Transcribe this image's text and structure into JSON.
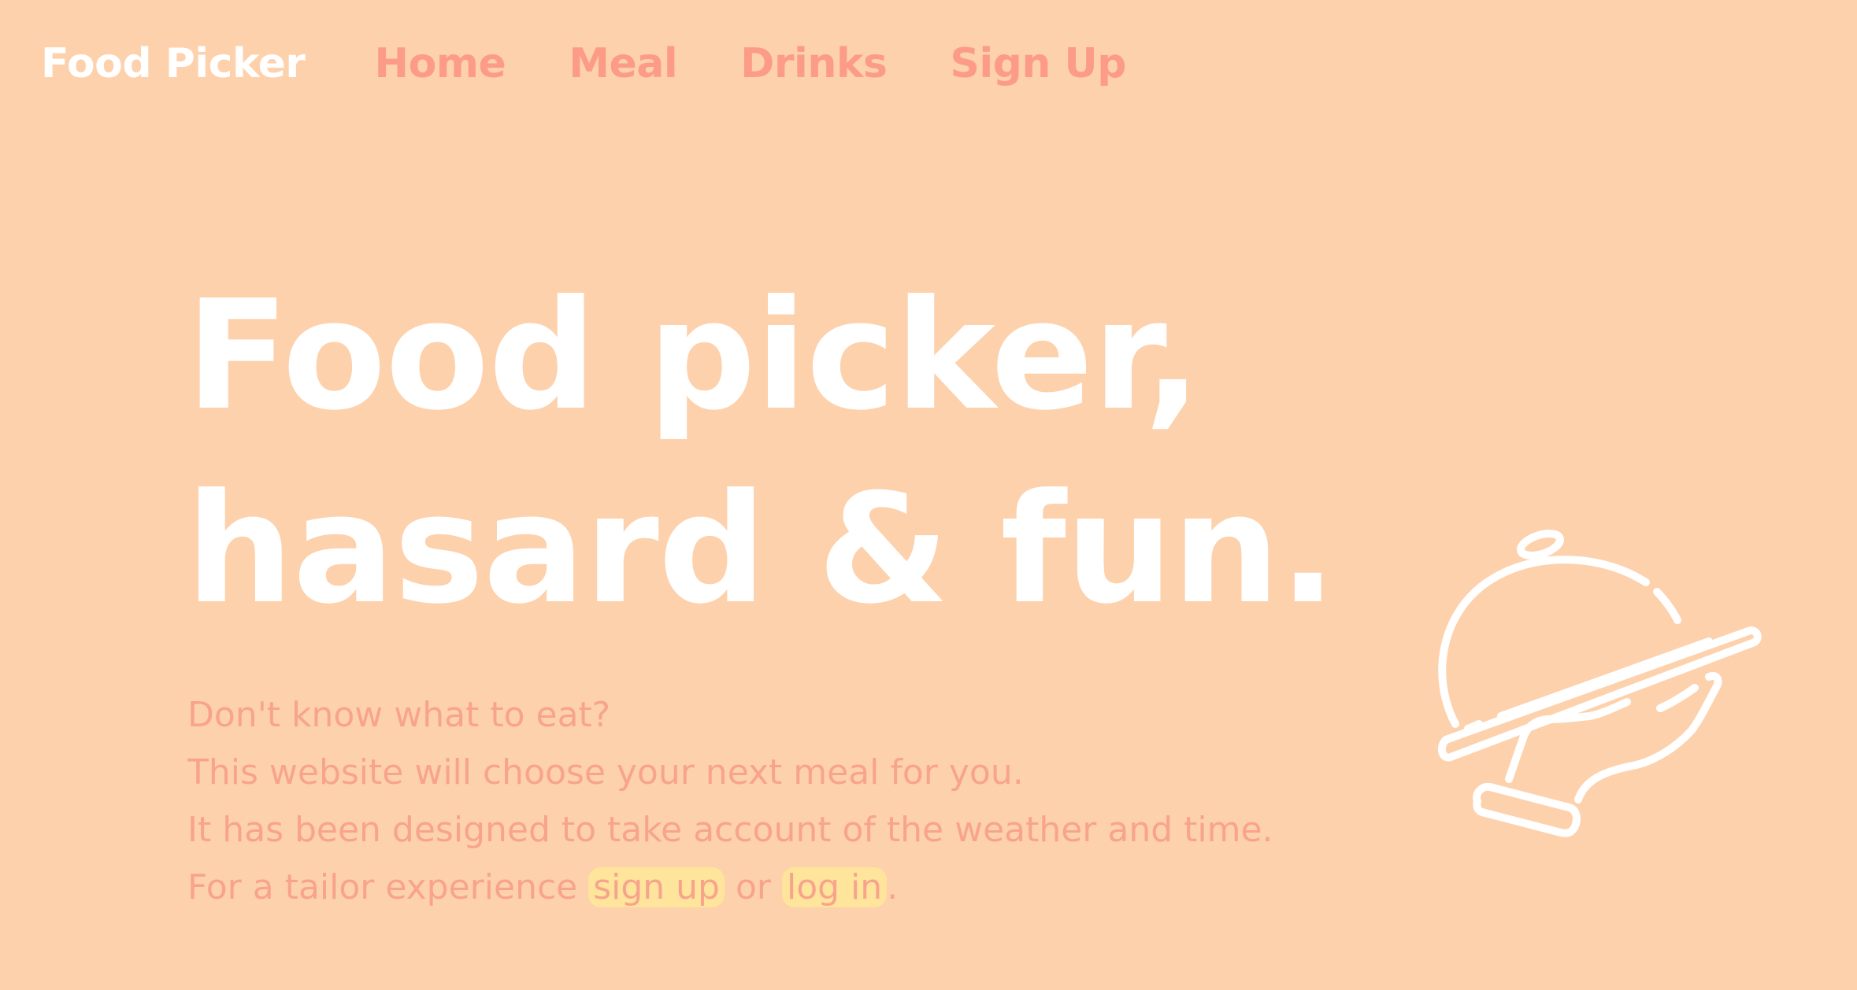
{
  "nav": {
    "brand": "Food Picker",
    "links": [
      {
        "label": "Home"
      },
      {
        "label": "Meal"
      },
      {
        "label": "Drinks"
      },
      {
        "label": "Sign Up"
      }
    ]
  },
  "hero": {
    "title_line1": "Food picker,",
    "title_line2": "hasard & fun.",
    "lines": [
      "Don't know what to eat?",
      "This website will choose your next meal for you.",
      "It has been designed to take account of the weather and time."
    ],
    "cta": {
      "prefix": "For a tailor experience ",
      "signup": "sign up",
      "middle": " or ",
      "login": "log in",
      "suffix": "."
    }
  },
  "illustration": {
    "icon": "serving-cloche-icon"
  },
  "colors": {
    "background": "#fdd1ac",
    "accent": "#fc9c87",
    "highlight": "#ffe49c",
    "title": "#ffffff"
  }
}
